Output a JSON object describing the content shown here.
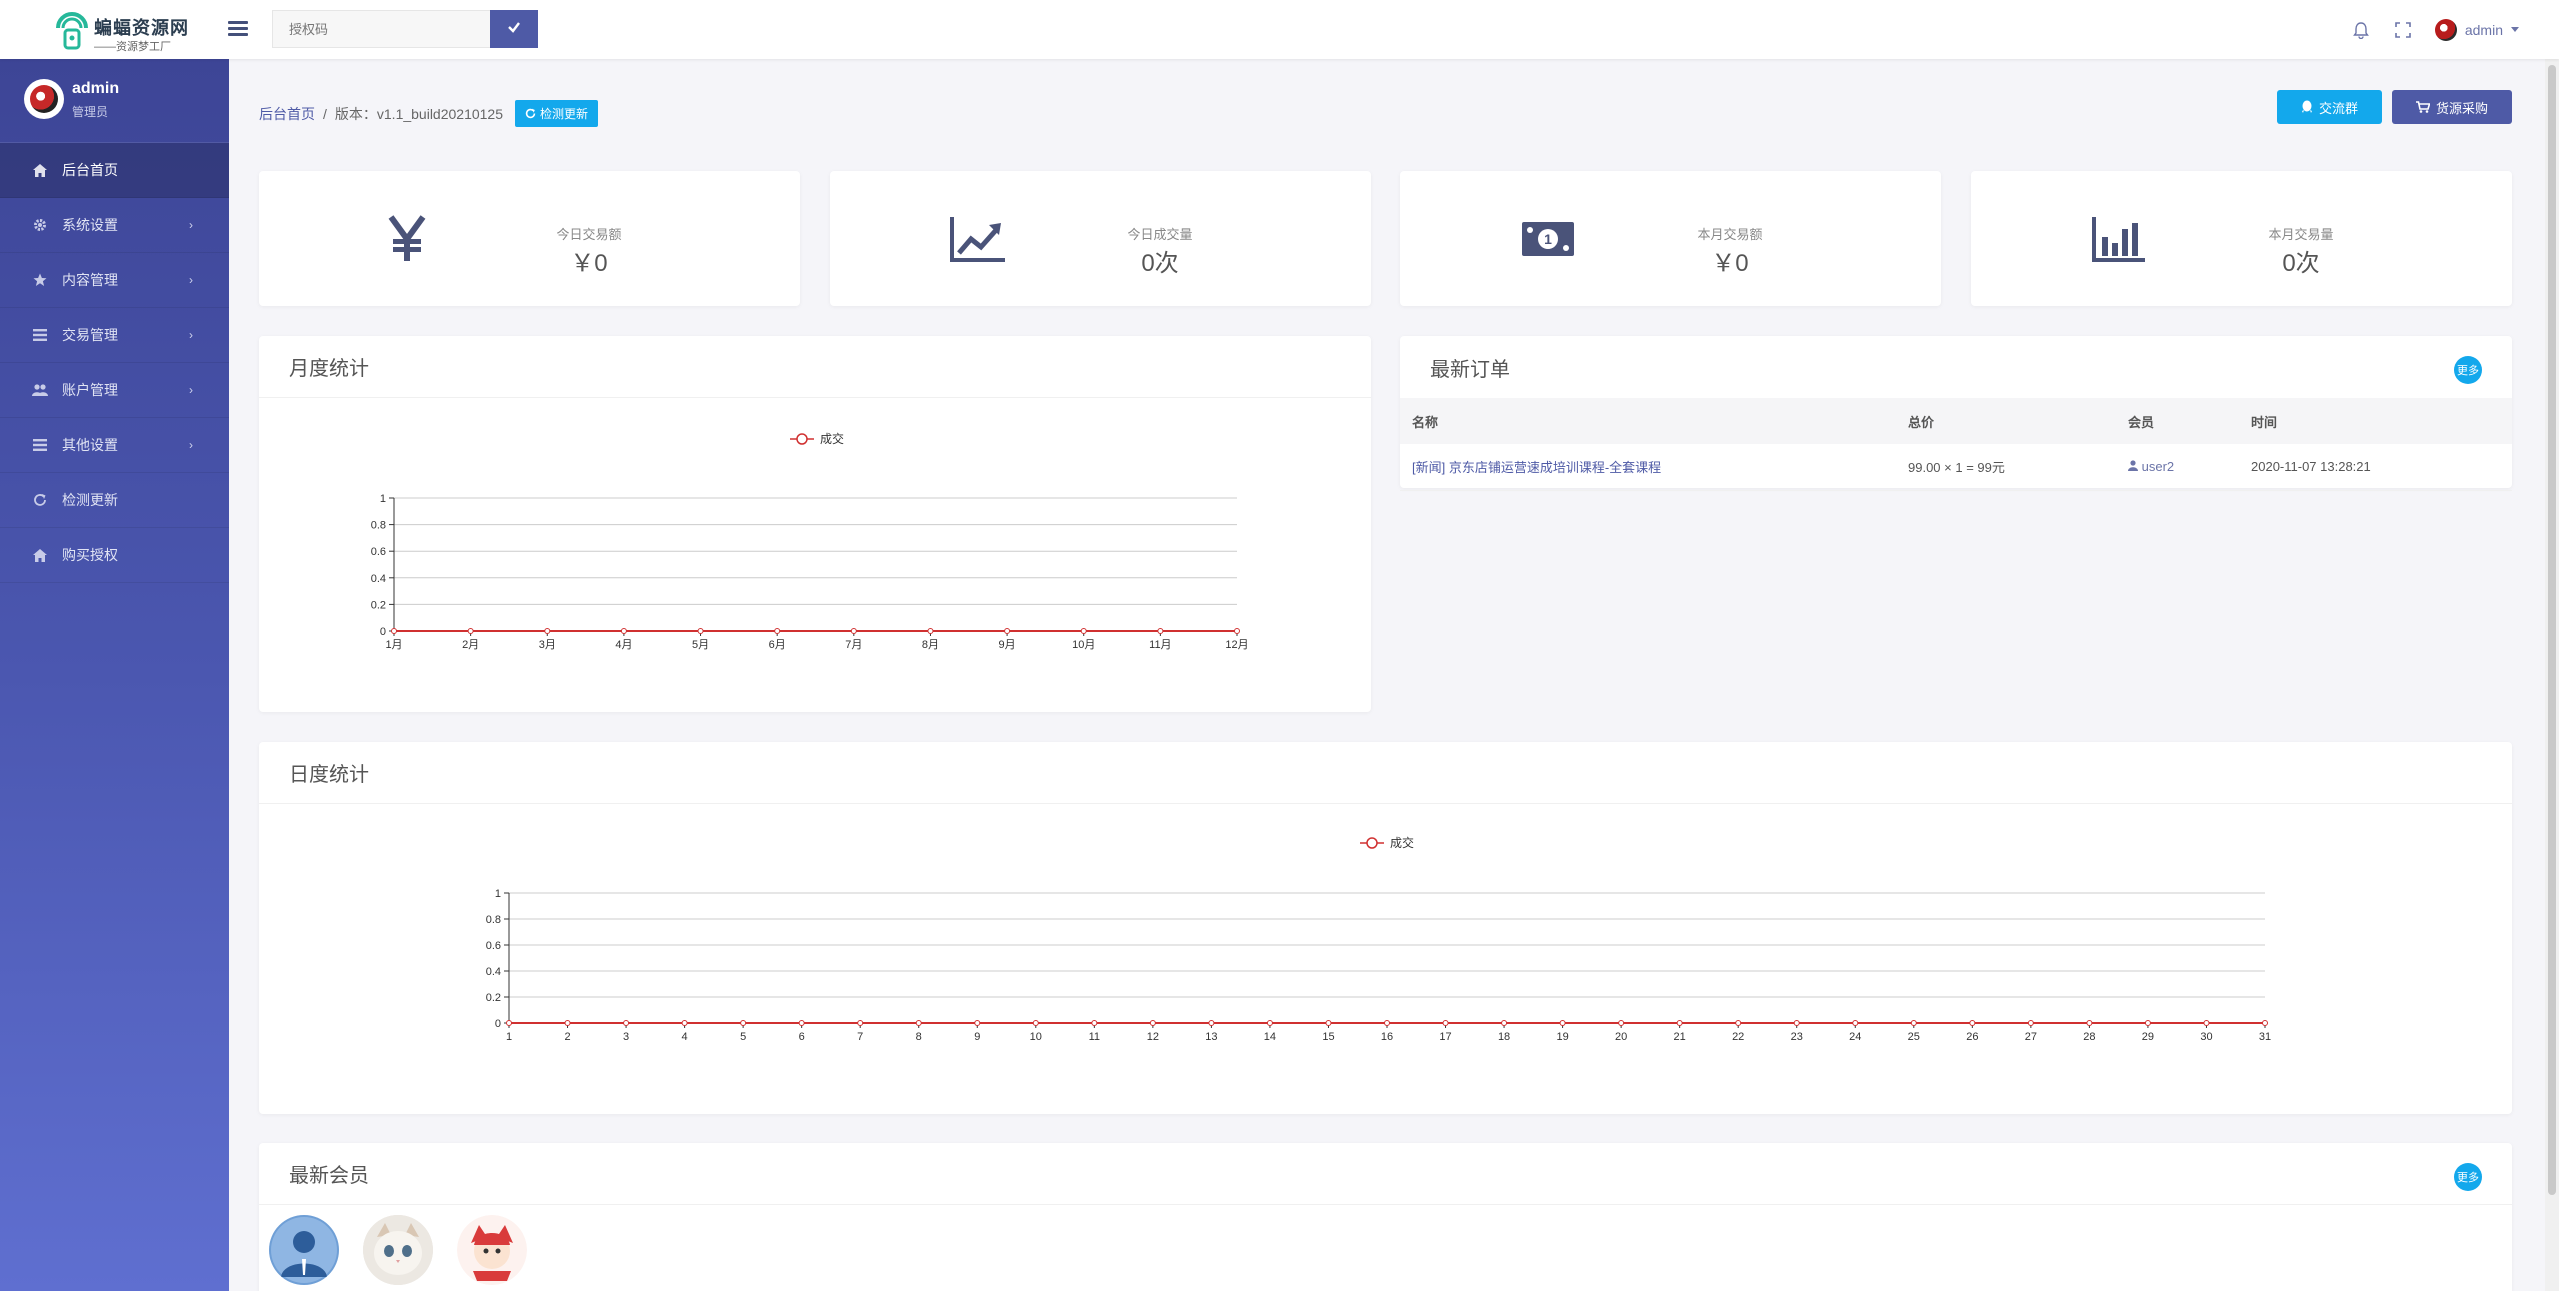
{
  "topbar": {
    "logo_name": "蝙蝠资源网",
    "logo_slogan": "——资源梦工厂",
    "license_placeholder": "授权码",
    "user_name": "admin"
  },
  "sidebar": {
    "user_name": "admin",
    "user_role": "管理员",
    "items": [
      {
        "label": "后台首页",
        "icon": "home-icon",
        "active": true,
        "has_children": false
      },
      {
        "label": "系统设置",
        "icon": "gear-icon",
        "active": false,
        "has_children": true
      },
      {
        "label": "内容管理",
        "icon": "star-icon",
        "active": false,
        "has_children": true
      },
      {
        "label": "交易管理",
        "icon": "list-icon",
        "active": false,
        "has_children": true
      },
      {
        "label": "账户管理",
        "icon": "users-icon",
        "active": false,
        "has_children": true
      },
      {
        "label": "其他设置",
        "icon": "list-icon",
        "active": false,
        "has_children": true
      },
      {
        "label": "检测更新",
        "icon": "refresh-icon",
        "active": false,
        "has_children": false
      },
      {
        "label": "购买授权",
        "icon": "home-icon",
        "active": false,
        "has_children": false
      }
    ]
  },
  "breadcrumb": {
    "home": "后台首页",
    "separator": "/",
    "version": "版本：v1.1_build20210125",
    "check_update": "检测更新"
  },
  "actions": {
    "group": "交流群",
    "buy": "货源采购"
  },
  "stats": [
    {
      "label": "今日交易额",
      "value": "￥0",
      "icon": "yen-icon"
    },
    {
      "label": "今日成交量",
      "value": "0次",
      "icon": "trend-up-icon"
    },
    {
      "label": "本月交易额",
      "value": "￥0",
      "icon": "money-icon"
    },
    {
      "label": "本月交易量",
      "value": "0次",
      "icon": "bar-chart-icon"
    }
  ],
  "monthly": {
    "title": "月度统计"
  },
  "daily": {
    "title": "日度统计"
  },
  "orders": {
    "title": "最新订单",
    "more": "更多",
    "columns": [
      "名称",
      "总价",
      "会员",
      "时间"
    ],
    "rows": [
      {
        "name": "[新闻] 京东店铺运营速成培训课程-全套课程",
        "total": "99.00 × 1 = 99元",
        "member": "user2",
        "time": "2020-11-07 13:28:21"
      }
    ]
  },
  "members": {
    "title": "最新会员",
    "more": "更多"
  },
  "chart_data": [
    {
      "type": "line",
      "legend": "成交",
      "x": [
        "1月",
        "2月",
        "3月",
        "4月",
        "5月",
        "6月",
        "7月",
        "8月",
        "9月",
        "10月",
        "11月",
        "12月"
      ],
      "series": [
        {
          "name": "成交",
          "values": [
            0,
            0,
            0,
            0,
            0,
            0,
            0,
            0,
            0,
            0,
            0,
            0
          ]
        }
      ],
      "ylim": [
        0,
        1
      ],
      "yticks": [
        "0",
        "0.2",
        "0.4",
        "0.6",
        "0.8",
        "1"
      ],
      "grid": true,
      "legend_position": "top-center"
    },
    {
      "type": "line",
      "legend": "成交",
      "x": [
        "1",
        "2",
        "3",
        "4",
        "5",
        "6",
        "7",
        "8",
        "9",
        "10",
        "11",
        "12",
        "13",
        "14",
        "15",
        "16",
        "17",
        "18",
        "19",
        "20",
        "21",
        "22",
        "23",
        "24",
        "25",
        "26",
        "27",
        "28",
        "29",
        "30",
        "31"
      ],
      "series": [
        {
          "name": "成交",
          "values": [
            0,
            0,
            0,
            0,
            0,
            0,
            0,
            0,
            0,
            0,
            0,
            0,
            0,
            0,
            0,
            0,
            0,
            0,
            0,
            0,
            0,
            0,
            0,
            0,
            0,
            0,
            0,
            0,
            0,
            0,
            0
          ]
        }
      ],
      "ylim": [
        0,
        1
      ],
      "yticks": [
        "0",
        "0.2",
        "0.4",
        "0.6",
        "0.8",
        "1"
      ],
      "grid": true,
      "legend_position": "top-center"
    }
  ]
}
